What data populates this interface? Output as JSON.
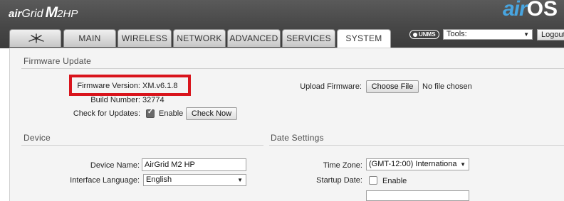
{
  "header": {
    "logo": {
      "air": "air",
      "grid": "Grid",
      "m": "M",
      "hp": "2HP"
    },
    "brand": {
      "air": "air",
      "os": "OS"
    },
    "tabs": [
      {
        "label": ""
      },
      {
        "label": "MAIN"
      },
      {
        "label": "WIRELESS"
      },
      {
        "label": "NETWORK"
      },
      {
        "label": "ADVANCED"
      },
      {
        "label": "SERVICES"
      },
      {
        "label": "SYSTEM"
      }
    ],
    "active_tab": "SYSTEM",
    "unms_label": "UNMS",
    "tools": {
      "selected": "Tools:"
    },
    "logout_label": "Logout",
    "ubiquiti_logo_icon": "ubiquiti-logo-icon"
  },
  "firmware": {
    "title": "Firmware Update",
    "version_label": "Firmware Version:",
    "version_value": "XM.v6.1.8",
    "build_label": "Build Number:",
    "build_value": "32774",
    "check_label": "Check for Updates:",
    "enable_label": "Enable",
    "enable_checked": true,
    "check_now_label": "Check Now",
    "upload_label": "Upload Firmware:",
    "choose_file_label": "Choose File",
    "no_file_label": "No file chosen"
  },
  "device": {
    "title": "Device",
    "name_label": "Device Name:",
    "name_value": "AirGrid M2 HP",
    "language_label": "Interface Language:",
    "language_value": "English"
  },
  "date_settings": {
    "title": "Date Settings",
    "timezone_label": "Time Zone:",
    "timezone_value": "(GMT-12:00) Internationa",
    "startup_label": "Startup Date:",
    "startup_enable_label": "Enable",
    "startup_checked": false
  },
  "colors": {
    "highlight": "#d9141c",
    "header_bg": "#474747",
    "brand_blue": "#48a5e0"
  }
}
